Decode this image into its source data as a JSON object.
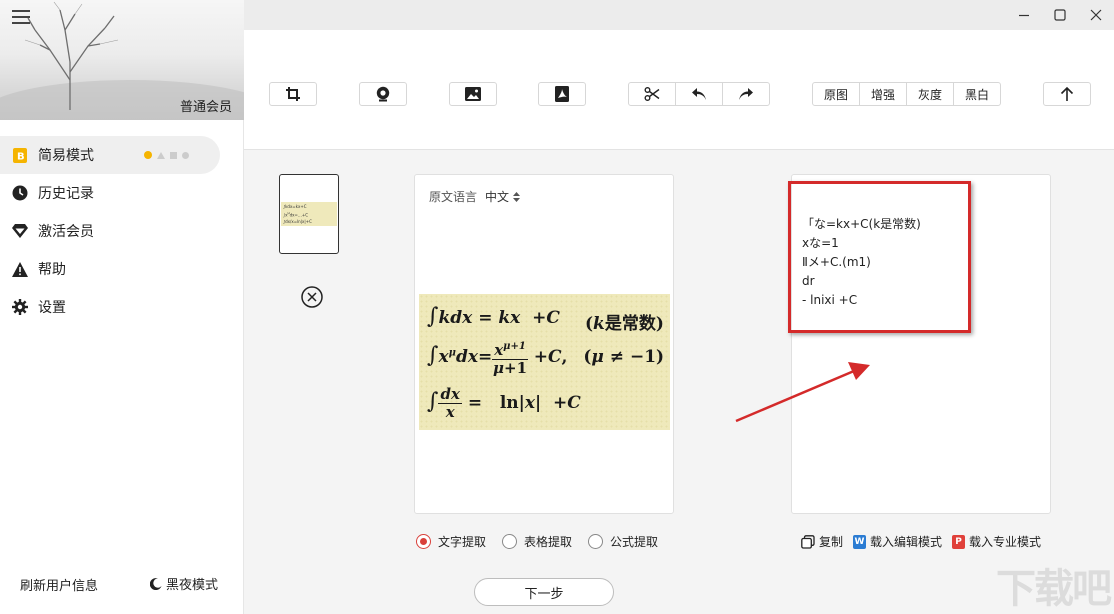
{
  "sidebar": {
    "member_label": "普通会员",
    "items": [
      {
        "label": "简易模式",
        "icon": "b-badge-icon"
      },
      {
        "label": "历史记录",
        "icon": "clock-icon"
      },
      {
        "label": "激活会员",
        "icon": "diamond-icon"
      },
      {
        "label": "帮助",
        "icon": "warning-icon"
      },
      {
        "label": "设置",
        "icon": "gear-icon"
      }
    ],
    "refresh_label": "刷新用户信息",
    "night_mode_label": "黑夜模式"
  },
  "toolbar": {
    "image_modes": [
      "原图",
      "增强",
      "灰度",
      "黑白"
    ]
  },
  "source_panel": {
    "lang_label": "原文语言",
    "lang_value": "中文"
  },
  "result_panel": {
    "lines": [
      "「な=kx+C(k是常数)",
      "xな=1",
      "Ⅱメ+C.(m1)",
      "dr",
      "- lnixi +C"
    ]
  },
  "extract_modes": {
    "options": [
      "文字提取",
      "表格提取",
      "公式提取"
    ],
    "selected": "文字提取"
  },
  "result_actions": {
    "copy": "复制",
    "edit_mode": "载入编辑模式",
    "pro_mode": "载入专业模式"
  },
  "next_label": "下一步",
  "colors": {
    "accent_red": "#d9403a",
    "highlight_red": "#d42a2a",
    "word_blue": "#2b7cd3",
    "pdf_red": "#e0403a",
    "mode_dot_yellow": "#f5b400"
  }
}
